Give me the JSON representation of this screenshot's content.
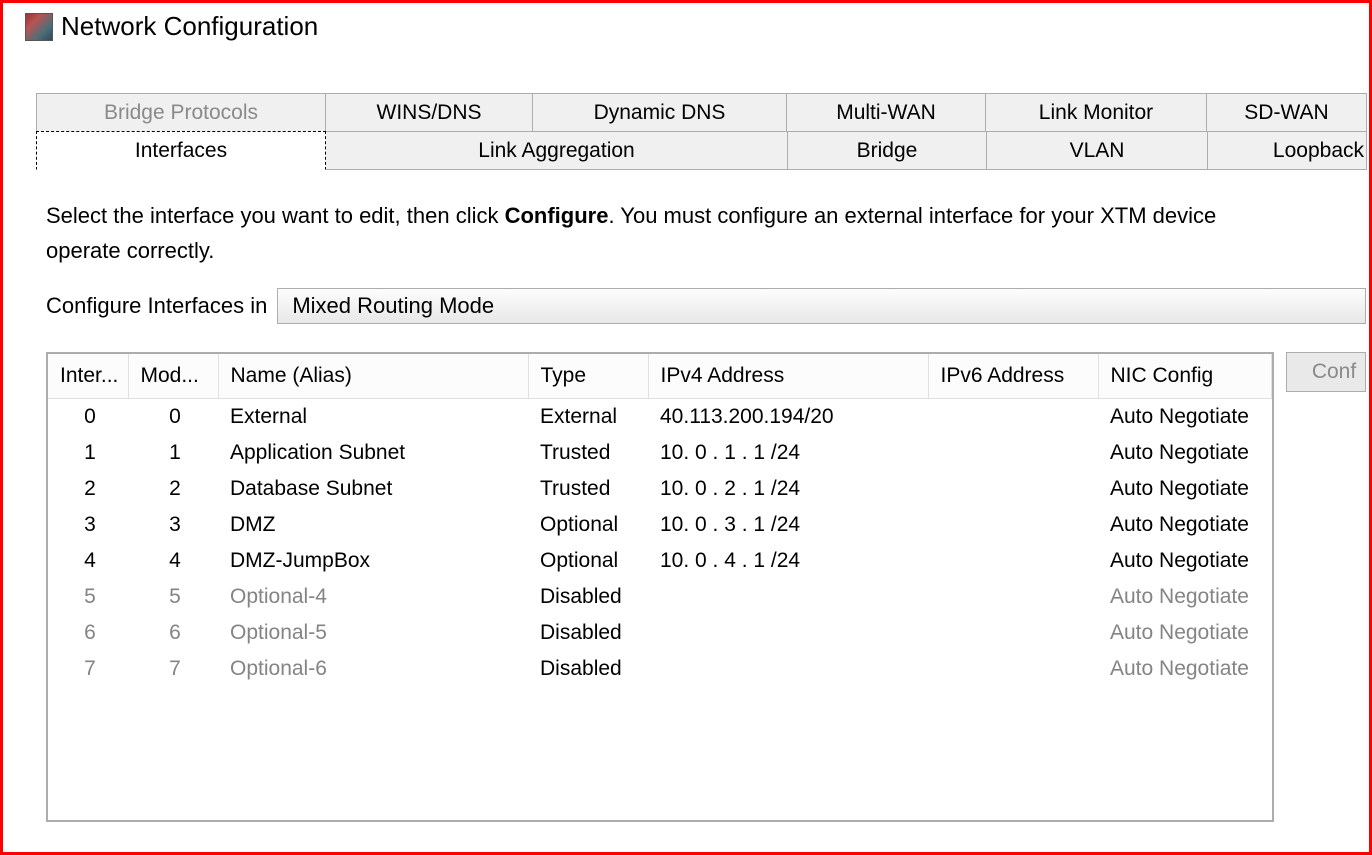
{
  "window": {
    "title": "Network Configuration"
  },
  "tabs_row1": [
    {
      "label": "Bridge Protocols",
      "state": "disabled"
    },
    {
      "label": "WINS/DNS",
      "state": "normal"
    },
    {
      "label": "Dynamic DNS",
      "state": "normal"
    },
    {
      "label": "Multi-WAN",
      "state": "normal"
    },
    {
      "label": "Link Monitor",
      "state": "normal"
    },
    {
      "label": "SD-WAN",
      "state": "normal"
    }
  ],
  "tabs_row2": [
    {
      "label": "Interfaces",
      "state": "active"
    },
    {
      "label": "Link Aggregation",
      "state": "normal"
    },
    {
      "label": "Bridge",
      "state": "normal"
    },
    {
      "label": "VLAN",
      "state": "normal"
    },
    {
      "label": "Loopback",
      "state": "normal"
    }
  ],
  "instruction": {
    "pre": "Select the interface you want to edit, then click ",
    "bold": "Configure",
    "post": ". You must configure an external interface for your XTM device",
    "line2": "operate correctly."
  },
  "mode": {
    "label": "Configure Interfaces in",
    "value": "Mixed Routing Mode"
  },
  "columns": {
    "inter": "Inter...",
    "mod": "Mod...",
    "name": "Name (Alias)",
    "type": "Type",
    "ipv4": "IPv4 Address",
    "ipv6": "IPv6 Address",
    "nic": "NIC Config"
  },
  "rows": [
    {
      "inter": "0",
      "mod": "0",
      "name": "External",
      "type": "External",
      "ipv4": "40.113.200.194/20",
      "ipv6": "",
      "nic": "Auto Negotiate",
      "disabled": false
    },
    {
      "inter": "1",
      "mod": "1",
      "name": "Application Subnet",
      "type": "Trusted",
      "ipv4": "10. 0 . 1 . 1 /24",
      "ipv6": "",
      "nic": "Auto Negotiate",
      "disabled": false
    },
    {
      "inter": "2",
      "mod": "2",
      "name": "Database Subnet",
      "type": "Trusted",
      "ipv4": "10. 0 . 2 . 1 /24",
      "ipv6": "",
      "nic": "Auto Negotiate",
      "disabled": false
    },
    {
      "inter": "3",
      "mod": "3",
      "name": "DMZ",
      "type": "Optional",
      "ipv4": "10. 0 . 3 . 1 /24",
      "ipv6": "",
      "nic": "Auto Negotiate",
      "disabled": false
    },
    {
      "inter": "4",
      "mod": "4",
      "name": "DMZ-JumpBox",
      "type": "Optional",
      "ipv4": "10. 0 . 4 . 1 /24",
      "ipv6": "",
      "nic": "Auto Negotiate",
      "disabled": false
    },
    {
      "inter": "5",
      "mod": "5",
      "name": "Optional-4",
      "type": "Disabled",
      "ipv4": "",
      "ipv6": "",
      "nic": "Auto Negotiate",
      "disabled": true
    },
    {
      "inter": "6",
      "mod": "6",
      "name": "Optional-5",
      "type": "Disabled",
      "ipv4": "",
      "ipv6": "",
      "nic": "Auto Negotiate",
      "disabled": true
    },
    {
      "inter": "7",
      "mod": "7",
      "name": "Optional-6",
      "type": "Disabled",
      "ipv4": "",
      "ipv6": "",
      "nic": "Auto Negotiate",
      "disabled": true
    }
  ],
  "buttons": {
    "configure": "Conf"
  }
}
